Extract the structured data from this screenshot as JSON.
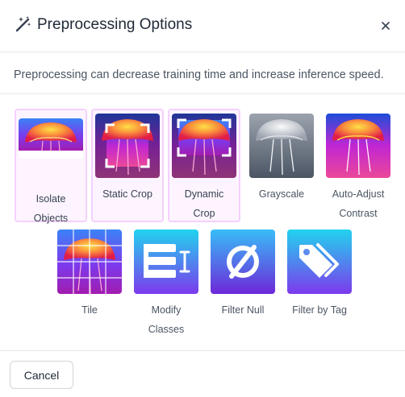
{
  "dialog": {
    "title": "Preprocessing Options",
    "description": "Preprocessing can decrease training time and increase inference speed.",
    "cancel_label": "Cancel"
  },
  "options": [
    {
      "label_line1": "Isolate",
      "label_line2": "Objects",
      "icon": "isolate-objects-icon",
      "selected": true
    },
    {
      "label_line1": "Static Crop",
      "label_line2": "",
      "icon": "static-crop-icon",
      "selected": true
    },
    {
      "label_line1": "Dynamic",
      "label_line2": "Crop",
      "icon": "dynamic-crop-icon",
      "selected": true
    },
    {
      "label_line1": "Grayscale",
      "label_line2": "",
      "icon": "grayscale-icon",
      "selected": false
    },
    {
      "label_line1": "Auto-Adjust",
      "label_line2": "Contrast",
      "icon": "auto-adjust-contrast-icon",
      "selected": false
    },
    {
      "label_line1": "Tile",
      "label_line2": "",
      "icon": "tile-icon",
      "selected": false
    },
    {
      "label_line1": "Modify",
      "label_line2": "Classes",
      "icon": "modify-classes-icon",
      "selected": false
    },
    {
      "label_line1": "Filter Null",
      "label_line2": "",
      "icon": "filter-null-icon",
      "selected": false
    },
    {
      "label_line1": "Filter by Tag",
      "label_line2": "",
      "icon": "filter-by-tag-icon",
      "selected": false
    }
  ],
  "colors": {
    "selected_border": "#f5d0fe",
    "selected_bg": "#fdf4ff",
    "icon_gradient_start": "#22d3ee",
    "icon_gradient_end": "#7c3aed"
  }
}
